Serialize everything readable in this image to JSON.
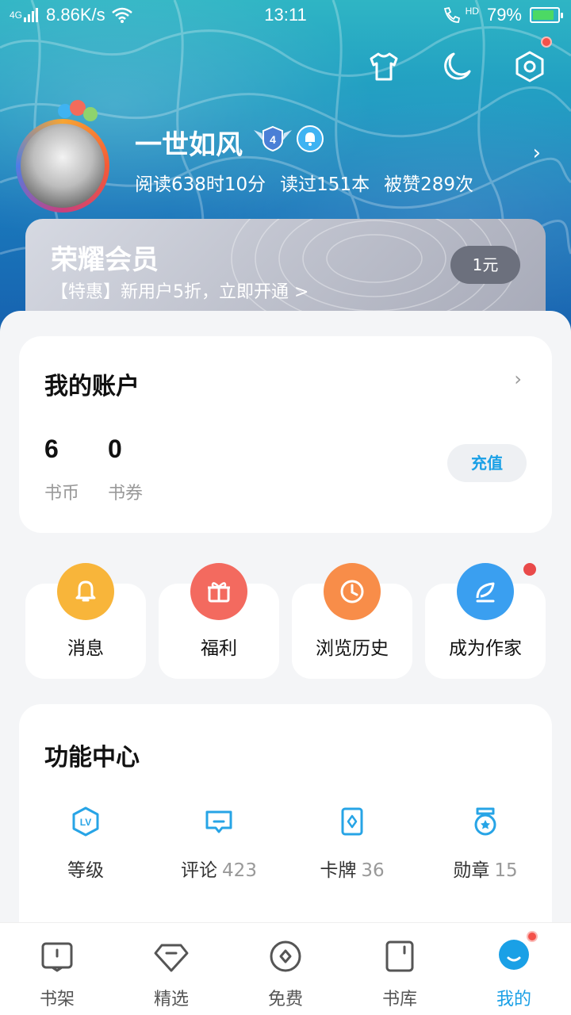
{
  "status_bar": {
    "network": "4G",
    "speed": "8.86K/s",
    "time": "13:11",
    "hd_label": "HD",
    "battery_percent": "79%",
    "battery_level": 0.79
  },
  "top_actions": [
    "shirt-icon",
    "moon-icon",
    "settings-hex-icon"
  ],
  "profile": {
    "username": "一世如风",
    "level": "4",
    "stats": [
      "阅读638时10分",
      "读过151本",
      "被赞289次"
    ]
  },
  "member": {
    "title": "荣耀会员",
    "subtitle": "【特惠】新用户5折，立即开通 >",
    "button": "1元"
  },
  "account": {
    "title": "我的账户",
    "items": [
      {
        "value": "6",
        "label": "书币"
      },
      {
        "value": "0",
        "label": "书券"
      }
    ],
    "recharge": "充值"
  },
  "quick_entries": [
    {
      "label": "消息",
      "icon": "bell-icon",
      "color": "#f8b53a"
    },
    {
      "label": "福利",
      "icon": "gift-icon",
      "color": "#f36a5f"
    },
    {
      "label": "浏览历史",
      "icon": "clock-icon",
      "color": "#f88d49"
    },
    {
      "label": "成为作家",
      "icon": "quill-icon",
      "color": "#3a9ff0"
    }
  ],
  "function_center": {
    "title": "功能中心",
    "items": [
      {
        "label": "等级",
        "count": "",
        "icon": "level-icon"
      },
      {
        "label": "评论",
        "count": "423",
        "icon": "comment-icon"
      },
      {
        "label": "卡牌",
        "count": "36",
        "icon": "card-icon"
      },
      {
        "label": "勋章",
        "count": "15",
        "icon": "medal-icon"
      }
    ]
  },
  "bottom_nav": [
    {
      "label": "书架",
      "icon": "bookshelf-icon",
      "active": false
    },
    {
      "label": "精选",
      "icon": "diamond-icon",
      "active": false
    },
    {
      "label": "免费",
      "icon": "coin-icon",
      "active": false
    },
    {
      "label": "书库",
      "icon": "library-icon",
      "active": false
    },
    {
      "label": "我的",
      "icon": "profile-mascot-icon",
      "active": true
    }
  ],
  "colors": {
    "accent": "#1aa0e6",
    "badge_red": "#f4514a"
  }
}
